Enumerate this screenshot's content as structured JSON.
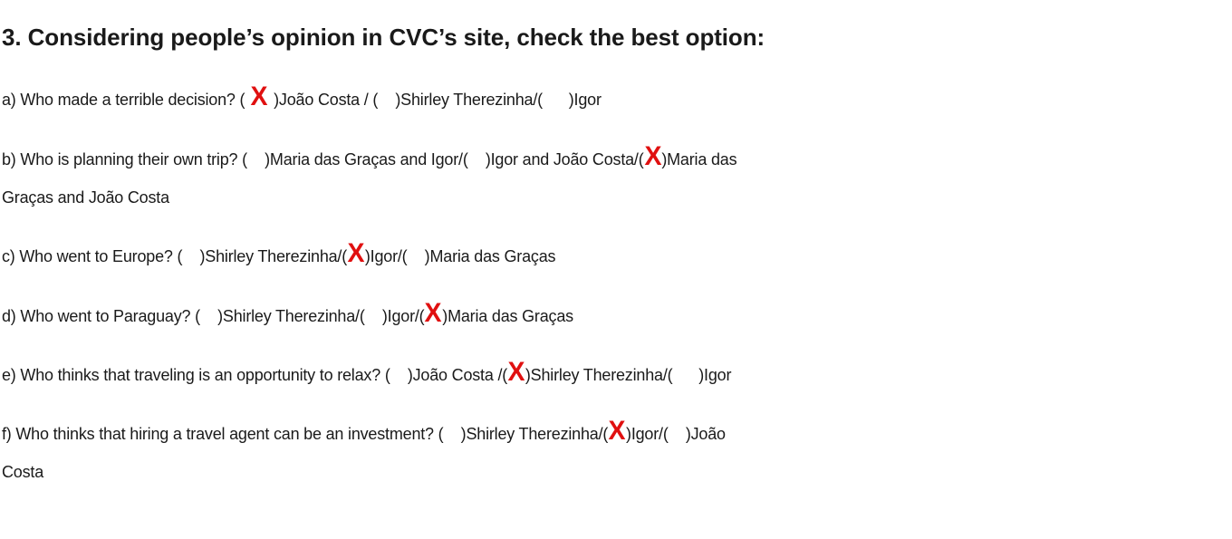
{
  "title": "3. Considering people’s opinion in CVC’s site, check the best option:",
  "questions": {
    "a": {
      "prefix": "a) Who made a terrible decision? (",
      "mark": "X",
      "opt1": ")João Costa / (    )Shirley Therezinha/(      )Igor"
    },
    "b": {
      "prefix": "b) Who is planning their own trip? (    )Maria das Graças and Igor/(    )Igor and João Costa/(",
      "mark": "X",
      "suffix": ")Maria das",
      "line2": "Graças and João Costa"
    },
    "c": {
      "prefix": "c) Who went to Europe? (    )Shirley Therezinha/(",
      "mark": "X",
      "suffix": ")Igor/(    )Maria das Graças"
    },
    "d": {
      "prefix": "d) Who went to Paraguay? (    )Shirley Therezinha/(    )Igor/(",
      "mark": "X",
      "suffix": ")Maria das Graças"
    },
    "e": {
      "prefix": "e) Who thinks that traveling is an opportunity to relax? (    )João Costa /(",
      "mark": "X",
      "suffix": ")Shirley Therezinha/(      )Igor"
    },
    "f": {
      "prefix": "f) Who thinks that hiring a travel agent can be an investment? (    )Shirley Therezinha/(",
      "mark": "X",
      "suffix": ")Igor/(    )João",
      "line2": "Costa"
    }
  },
  "colors": {
    "mark": "#e01010",
    "text": "#1a1a1a"
  }
}
